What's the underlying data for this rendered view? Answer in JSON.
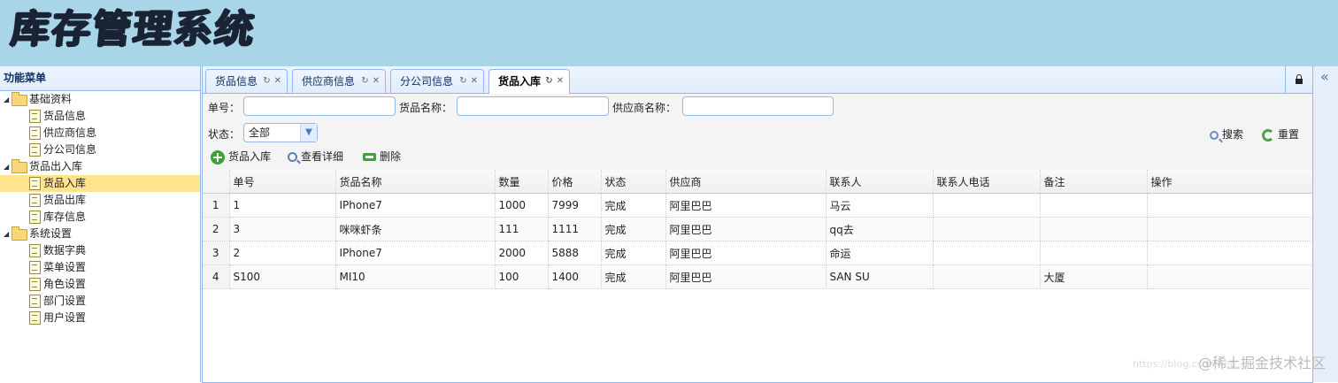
{
  "app": {
    "title": "库存管理系统"
  },
  "menu": {
    "title": "功能菜单",
    "groups": [
      {
        "label": "基础资料",
        "items": [
          "货品信息",
          "供应商信息",
          "分公司信息"
        ]
      },
      {
        "label": "货品出入库",
        "items": [
          "货品入库",
          "货品出库",
          "库存信息"
        ]
      },
      {
        "label": "系统设置",
        "items": [
          "数据字典",
          "菜单设置",
          "角色设置",
          "部门设置",
          "用户设置"
        ]
      }
    ],
    "selected": "货品入库"
  },
  "tabs": [
    {
      "label": "货品信息"
    },
    {
      "label": "供应商信息"
    },
    {
      "label": "分公司信息"
    },
    {
      "label": "货品入库",
      "active": true
    }
  ],
  "filters": {
    "order_no_label": "单号：",
    "goods_name_label": "货品名称：",
    "supplier_name_label": "供应商名称：",
    "status_label": "状态：",
    "status_value": "全部",
    "search_label": "搜索",
    "reset_label": "重置"
  },
  "actions": {
    "add_label": "货品入库",
    "detail_label": "查看详细",
    "delete_label": "删除"
  },
  "grid": {
    "columns": [
      "单号",
      "货品名称",
      "数量",
      "价格",
      "状态",
      "供应商",
      "联系人",
      "联系人电话",
      "备注",
      "操作"
    ],
    "rows": [
      [
        "1",
        "IPhone7",
        "1000",
        "7999",
        "完成",
        "阿里巴巴",
        "马云",
        "",
        "",
        ""
      ],
      [
        "3",
        "咪咪虾条",
        "111",
        "1111",
        "完成",
        "阿里巴巴",
        "qq去",
        "",
        "",
        ""
      ],
      [
        "2",
        "IPhone7",
        "2000",
        "5888",
        "完成",
        "阿里巴巴",
        "命运",
        "",
        "",
        ""
      ],
      [
        "S100",
        "MI10",
        "100",
        "1400",
        "完成",
        "阿里巴巴",
        "SAN SU",
        "",
        "大厦",
        ""
      ]
    ]
  },
  "watermark": {
    "text": "@稀土掘金技术社区",
    "url_text": "https://blog.csdn.net/..."
  },
  "colors": {
    "header_bg": "#a8d5e7",
    "selected_bg": "#ffe48d",
    "border": "#95b8e7"
  }
}
